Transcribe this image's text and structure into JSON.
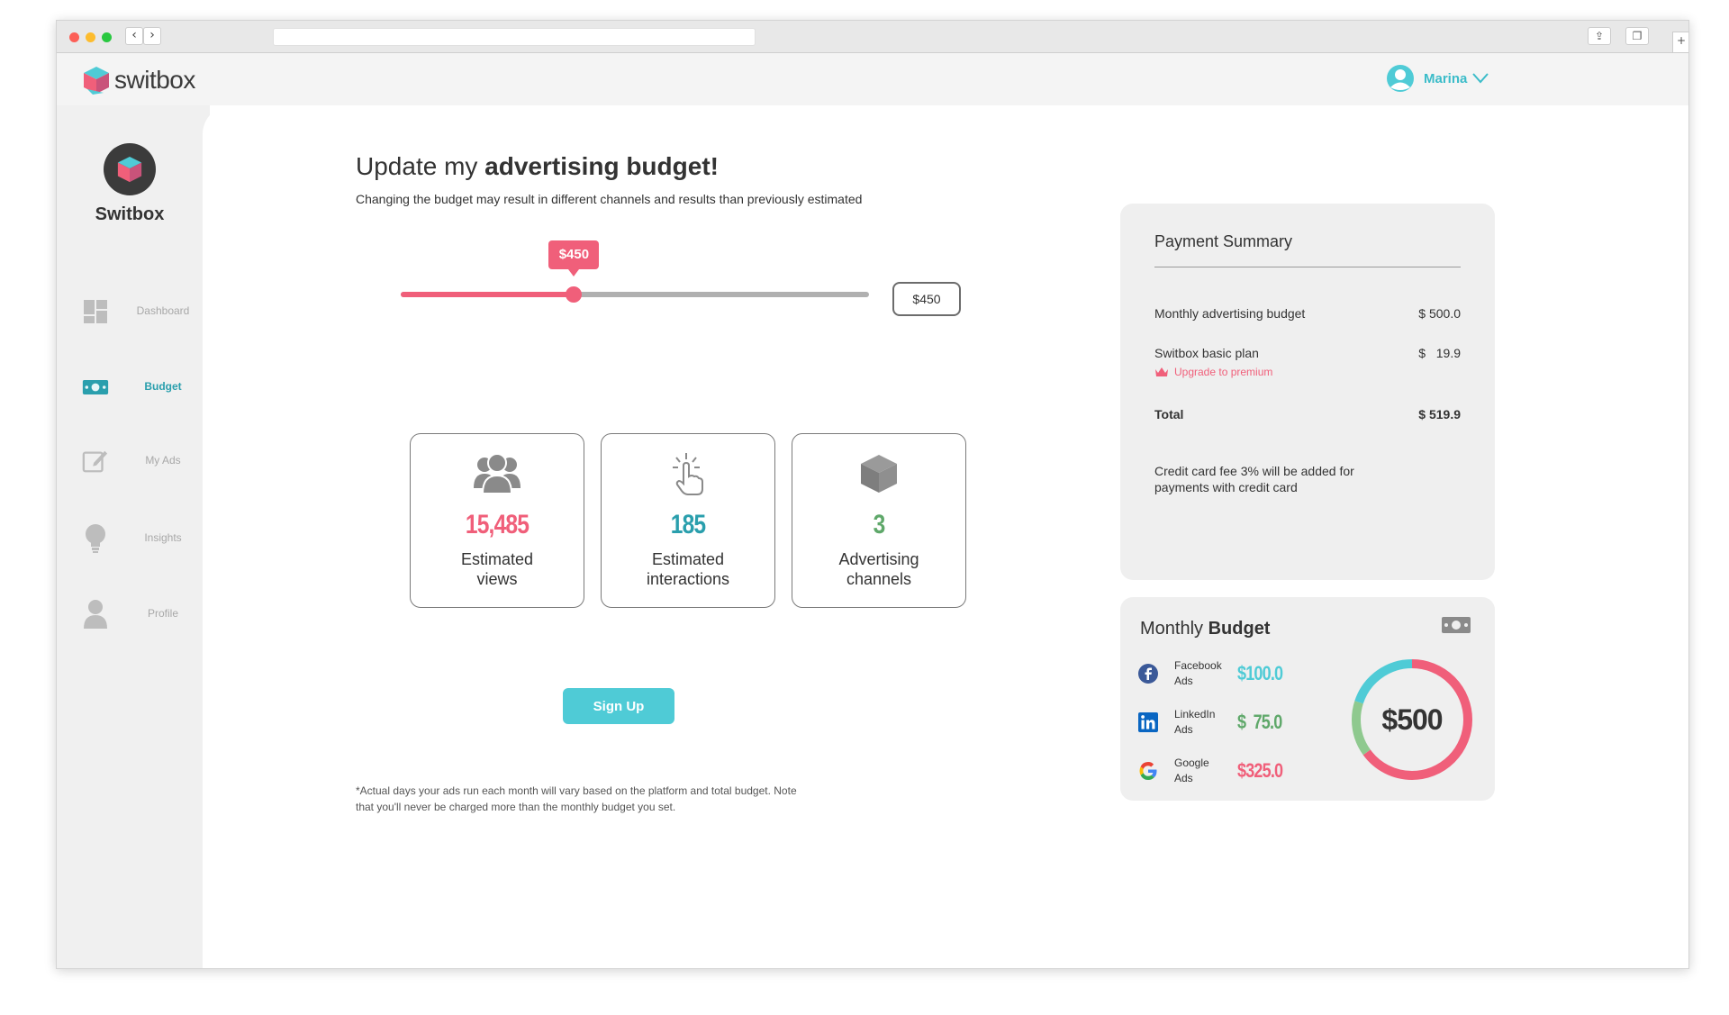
{
  "app": {
    "brand": "switbox",
    "user_name": "Marina"
  },
  "sidebar": {
    "org_name": "Switbox",
    "items": [
      {
        "label": "Dashboard",
        "icon": "dashboard-icon",
        "active": false
      },
      {
        "label": "Budget",
        "icon": "cash-icon",
        "active": true
      },
      {
        "label": "My Ads",
        "icon": "edit-icon",
        "active": false
      },
      {
        "label": "Insights",
        "icon": "lightbulb-icon",
        "active": false
      },
      {
        "label": "Profile",
        "icon": "person-icon",
        "active": false
      }
    ]
  },
  "main": {
    "title_prefix": "Update my ",
    "title_bold": "advertising budget!",
    "subtitle": "Changing the budget may result in different channels and results than previously estimated",
    "slider": {
      "value_label": "$450",
      "fraction": 0.37
    },
    "budget_input": "$450",
    "cards": [
      {
        "value": "15,485",
        "label_line1": "Estimated",
        "label_line2": "views",
        "color": "#f05f7a",
        "icon": "users-icon"
      },
      {
        "value": "185",
        "label_line1": "Estimated",
        "label_line2": "interactions",
        "color": "#2a9fad",
        "icon": "tap-icon"
      },
      {
        "value": "3",
        "label_line1": "Advertising",
        "label_line2": "channels",
        "color": "#5fa86a",
        "icon": "cube-icon"
      }
    ],
    "signup_label": "Sign Up",
    "footnote": "*Actual days your ads run each month will vary based on the platform and total budget.  Note that you'll never be charged more than the monthly budget you set."
  },
  "payment_summary": {
    "title": "Payment Summary",
    "rows": [
      {
        "label": "Monthly advertising budget",
        "amount": "$ 500.0"
      },
      {
        "label": "Switbox basic plan",
        "amount": "$   19.9"
      }
    ],
    "upgrade_label": "Upgrade to premium",
    "total_label": "Total",
    "total_amount": "$ 519.9",
    "note": "Credit card fee 3% will be added for payments with credit card"
  },
  "monthly_budget": {
    "title_prefix": "Monthly ",
    "title_bold": "Budget",
    "total": "$500",
    "channels": [
      {
        "line1": "Facebook",
        "line2": "Ads",
        "amount": "$100.0",
        "value": 100,
        "color": "#4fcbd6",
        "icon": "facebook-icon"
      },
      {
        "line1": "LinkedIn",
        "line2": "Ads",
        "amount": "$  75.0",
        "value": 75,
        "color": "#8fc98f",
        "icon": "linkedin-icon"
      },
      {
        "line1": "Google",
        "line2": "Ads",
        "amount": "$325.0",
        "value": 325,
        "color": "#f05f7a",
        "icon": "google-icon"
      }
    ]
  }
}
